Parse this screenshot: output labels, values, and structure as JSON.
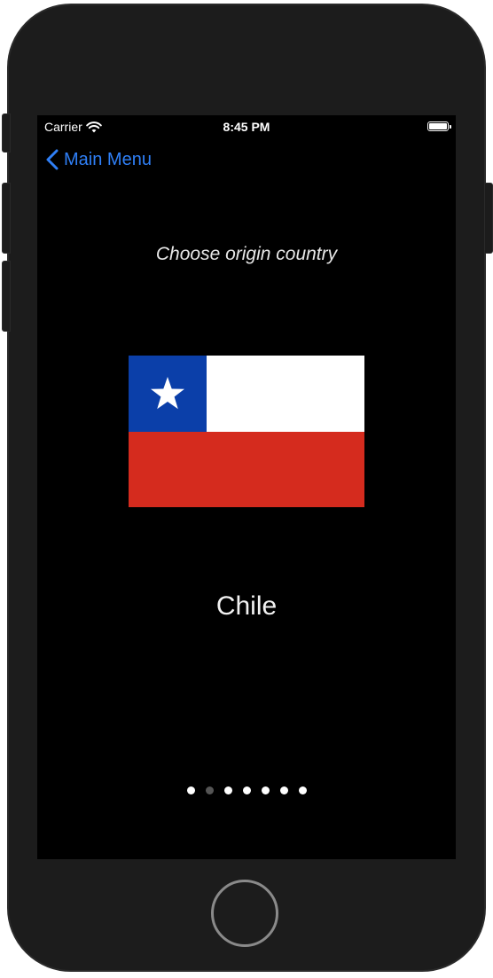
{
  "status_bar": {
    "carrier": "Carrier",
    "time": "8:45 PM"
  },
  "nav": {
    "back_label": "Main Menu"
  },
  "content": {
    "prompt": "Choose origin country",
    "country_name": "Chile",
    "flag_icon": "chile-flag"
  },
  "pager": {
    "total_pages": 7,
    "current_page": 2
  },
  "colors": {
    "accent": "#2f7ff6",
    "flag_blue": "#0b3fa9",
    "flag_white": "#ffffff",
    "flag_red": "#d52b1e"
  }
}
